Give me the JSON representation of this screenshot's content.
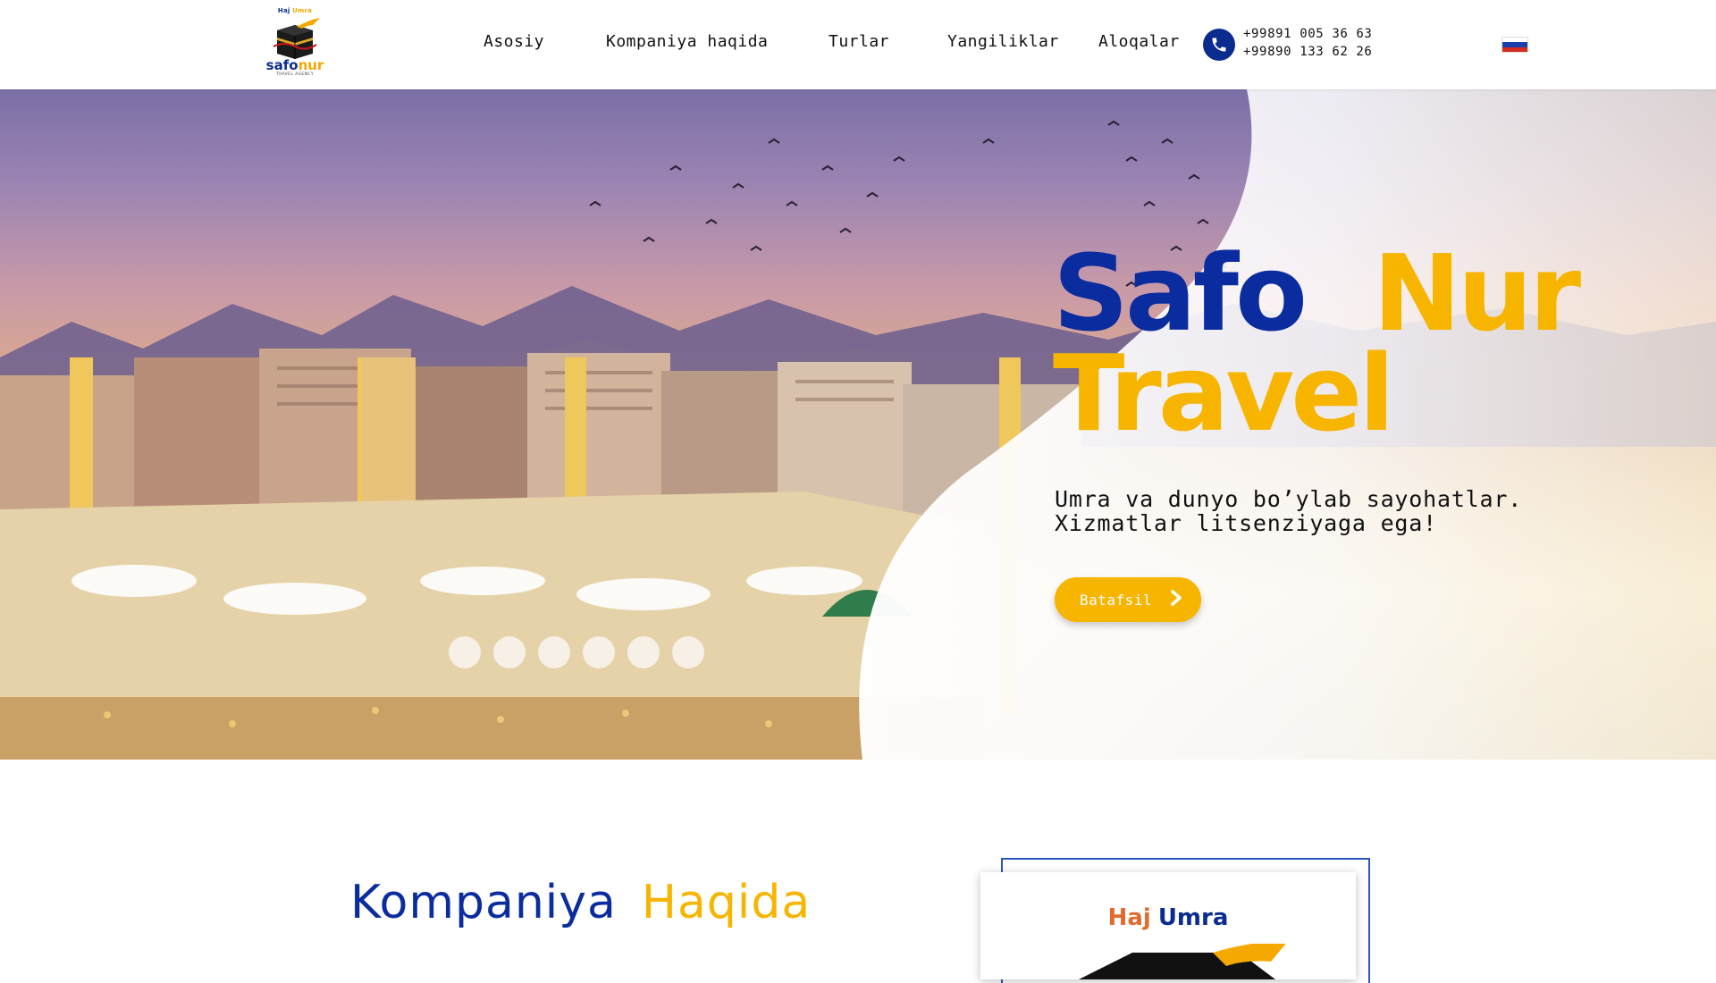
{
  "brand": {
    "logo_tag_haj": "Haj",
    "logo_tag_umra": "Umra",
    "logo_name_part1": "safo",
    "logo_name_part2": "nur",
    "logo_sub": "TRAVEL AGENCY"
  },
  "nav": {
    "items": [
      {
        "label": "Asosiy"
      },
      {
        "label": "Kompaniya haqida"
      },
      {
        "label": "Turlar"
      },
      {
        "label": "Yangiliklar"
      },
      {
        "label": "Aloqalar"
      }
    ]
  },
  "contact": {
    "phone_icon": "phone-icon",
    "phone1": "+99891 005 36 63",
    "phone2": "+99890 133 62 26"
  },
  "language": {
    "flag_icon": "russian-flag-icon",
    "flag_colors": [
      "#ffffff",
      "#1c3fb0",
      "#d52b1e"
    ]
  },
  "hero": {
    "title_word1": "Safo",
    "title_word2": "Nur",
    "title_word3": "Travel",
    "subtitle_line1": "Umra va dunyo bo’ylab sayohatlar.",
    "subtitle_line2": "Xizmatlar litsenziyaga ega!",
    "cta_label": "Batafsil",
    "cta_icon": "chevron-right-icon"
  },
  "about": {
    "title_word1": "Kompaniya",
    "title_word2": "Haqida",
    "card_word1": "Haj",
    "card_word2": "Umra"
  },
  "colors": {
    "brand_blue": "#0b2c9f",
    "brand_yellow": "#f7b500",
    "card_orange": "#e26a2c"
  }
}
